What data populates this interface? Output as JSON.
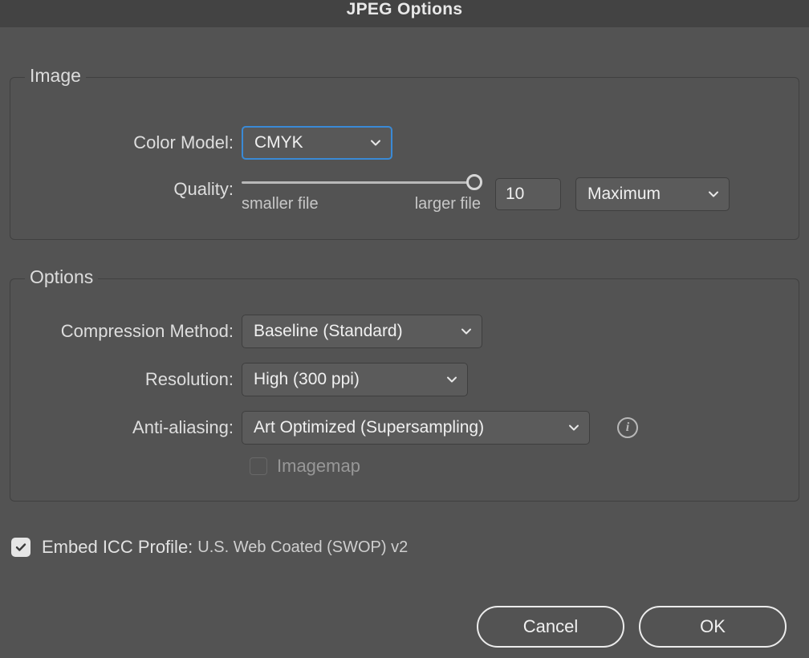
{
  "dialog": {
    "title": "JPEG Options"
  },
  "image_group": {
    "legend": "Image",
    "color_model": {
      "label": "Color Model:",
      "value": "CMYK"
    },
    "quality": {
      "label": "Quality:",
      "value": "10",
      "preset": "Maximum",
      "smaller_label": "smaller file",
      "larger_label": "larger file"
    }
  },
  "options_group": {
    "legend": "Options",
    "compression": {
      "label": "Compression Method:",
      "value": "Baseline (Standard)"
    },
    "resolution": {
      "label": "Resolution:",
      "value": "High (300 ppi)"
    },
    "anti_aliasing": {
      "label": "Anti-aliasing:",
      "value": "Art Optimized (Supersampling)"
    },
    "imagemap": {
      "label": "Imagemap",
      "checked": false
    }
  },
  "embed": {
    "label": "Embed ICC Profile:",
    "profile": "U.S. Web Coated (SWOP) v2",
    "checked": true
  },
  "buttons": {
    "cancel": "Cancel",
    "ok": "OK"
  },
  "icons": {
    "info_glyph": "i"
  }
}
